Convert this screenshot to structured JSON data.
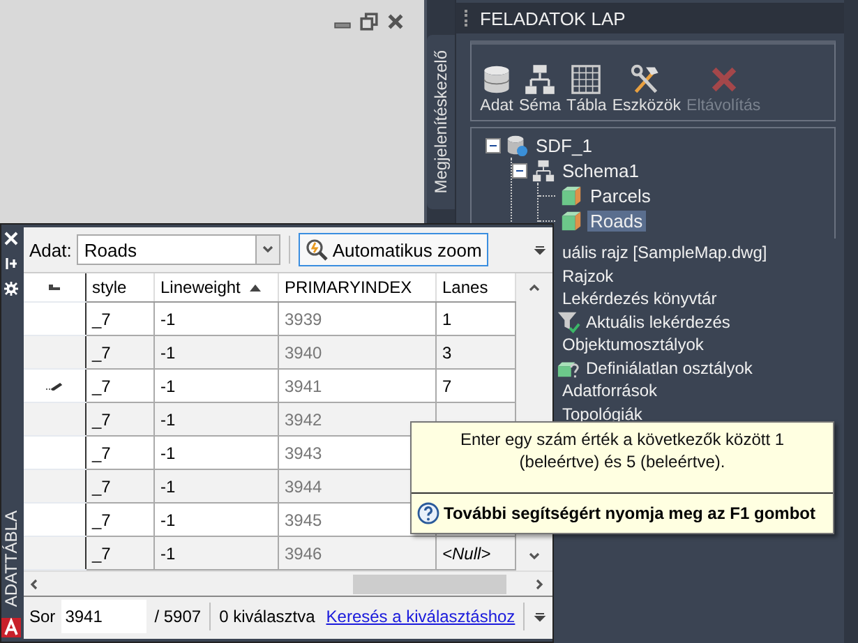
{
  "side_tab": {
    "label": "Megjelenítéskezelő"
  },
  "task_pane": {
    "title": "FELADATOK LAP",
    "toolbar": [
      {
        "label": "Adat",
        "kind": "database",
        "disabled": false
      },
      {
        "label": "Séma",
        "kind": "schema",
        "disabled": false
      },
      {
        "label": "Tábla",
        "kind": "table",
        "disabled": false
      },
      {
        "label": "Eszközök",
        "kind": "tools",
        "disabled": false
      },
      {
        "label": "Eltávolítás",
        "kind": "remove",
        "disabled": true
      }
    ],
    "tree": [
      {
        "label": "SDF_1",
        "kind": "source",
        "expanded": true,
        "selected": false,
        "children": [
          {
            "label": "Schema1",
            "kind": "schema",
            "expanded": true,
            "selected": false,
            "children": [
              {
                "label": "Parcels",
                "kind": "class",
                "selected": false
              },
              {
                "label": "Roads",
                "kind": "class",
                "selected": true
              }
            ]
          }
        ]
      }
    ],
    "list": [
      {
        "label": "uális rajz [SampleMap.dwg]",
        "kind": "plain"
      },
      {
        "label": "Rajzok",
        "kind": "plain"
      },
      {
        "label": "Lekérdezés könyvtár",
        "kind": "plain"
      },
      {
        "label": "Aktuális lekérdezés",
        "kind": "filter"
      },
      {
        "label": "Objektumosztályok",
        "kind": "plain"
      },
      {
        "label": "Definiálatlan osztályok",
        "kind": "undefined"
      },
      {
        "label": "Adatforrások",
        "kind": "plain"
      },
      {
        "label": "Topológiák",
        "kind": "plain"
      }
    ]
  },
  "data_table": {
    "title": "ADATTÁBLA",
    "data_label": "Adat:",
    "data_value": "Roads",
    "zoom_button": "Automatikus zoom",
    "columns": [
      {
        "label": "style",
        "readonly": false,
        "sorted": false
      },
      {
        "label": "Lineweight",
        "readonly": false,
        "sorted": true
      },
      {
        "label": "PRIMARYINDEX",
        "readonly": true,
        "sorted": false
      },
      {
        "label": "Lanes",
        "readonly": false,
        "sorted": false
      }
    ],
    "rows": [
      {
        "editing": false,
        "cells": [
          {
            "text": "_7",
            "kind": "value"
          },
          {
            "text": "-1",
            "kind": "value"
          },
          {
            "text": "3939",
            "kind": "value"
          },
          {
            "text": "1",
            "kind": "value"
          }
        ]
      },
      {
        "editing": false,
        "cells": [
          {
            "text": "_7",
            "kind": "value"
          },
          {
            "text": "-1",
            "kind": "value"
          },
          {
            "text": "3940",
            "kind": "value"
          },
          {
            "text": "3",
            "kind": "value"
          }
        ]
      },
      {
        "editing": true,
        "cells": [
          {
            "text": "_7",
            "kind": "value"
          },
          {
            "text": "-1",
            "kind": "value"
          },
          {
            "text": "3941",
            "kind": "value"
          },
          {
            "text": "7",
            "kind": "value"
          }
        ]
      },
      {
        "editing": false,
        "cells": [
          {
            "text": "_7",
            "kind": "value"
          },
          {
            "text": "-1",
            "kind": "value"
          },
          {
            "text": "3942",
            "kind": "value"
          }
        ]
      },
      {
        "editing": false,
        "cells": [
          {
            "text": "_7",
            "kind": "value"
          },
          {
            "text": "-1",
            "kind": "value"
          },
          {
            "text": "3943",
            "kind": "value"
          }
        ]
      },
      {
        "editing": false,
        "cells": [
          {
            "text": "_7",
            "kind": "value"
          },
          {
            "text": "-1",
            "kind": "value"
          },
          {
            "text": "3944",
            "kind": "value"
          }
        ]
      },
      {
        "editing": false,
        "cells": [
          {
            "text": "_7",
            "kind": "value"
          },
          {
            "text": "-1",
            "kind": "value"
          },
          {
            "text": "3945",
            "kind": "value"
          }
        ]
      },
      {
        "editing": false,
        "cells": [
          {
            "text": "_7",
            "kind": "value"
          },
          {
            "text": "-1",
            "kind": "value"
          },
          {
            "text": "3946",
            "kind": "value"
          },
          {
            "text": "<Null>",
            "kind": "null"
          }
        ]
      }
    ],
    "status": {
      "row_label": "Sor",
      "row_value": "3941",
      "total": "/ 5907",
      "selected_count": "0 kiválasztva",
      "link": "Keresés a kiválasztáshoz"
    }
  },
  "tooltip": {
    "text": "Enter egy szám érték a következők között 1 (beleértve) és 5 (beleértve).",
    "help": "További segítségért nyomja meg az F1 gombot"
  }
}
